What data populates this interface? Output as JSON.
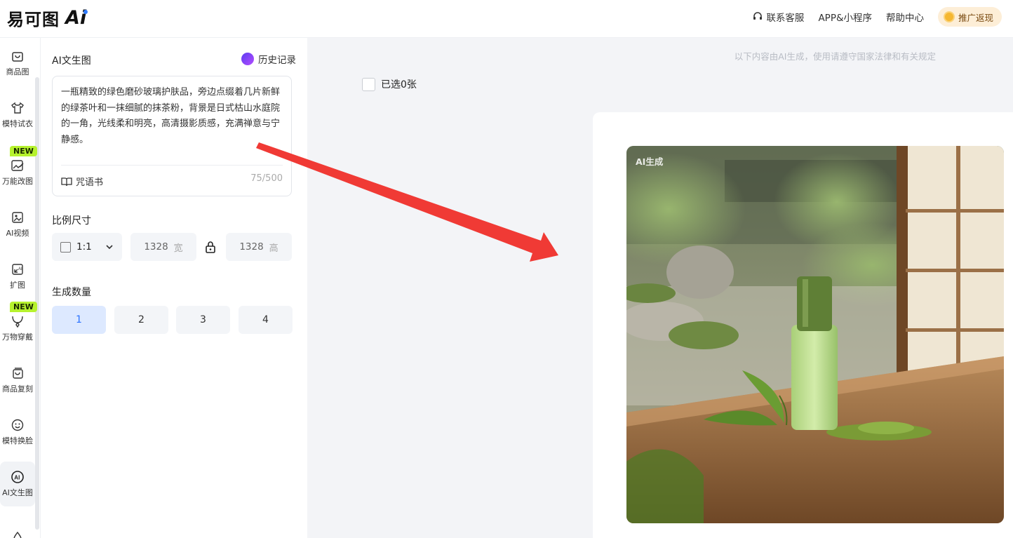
{
  "header": {
    "logo_text": "易可图",
    "logo_ai": "Ai",
    "nav": {
      "support": "联系客服",
      "app": "APP&小程序",
      "help": "帮助中心",
      "promo": "推广返现"
    }
  },
  "sidebar": {
    "items": [
      {
        "label": "商品图",
        "icon": "bag-icon"
      },
      {
        "label": "模特试衣",
        "icon": "shirt-icon"
      },
      {
        "label": "万能改图",
        "icon": "edit-image-icon",
        "badge": "NEW"
      },
      {
        "label": "AI视频",
        "icon": "video-icon"
      },
      {
        "label": "扩图",
        "icon": "expand-icon"
      },
      {
        "label": "万物穿戴",
        "icon": "necklace-icon",
        "badge": "NEW"
      },
      {
        "label": "商品复刻",
        "icon": "copy-bag-icon"
      },
      {
        "label": "模特换脸",
        "icon": "face-icon"
      },
      {
        "label": "AI文生图",
        "icon": "ai-text-image-icon",
        "active": true
      }
    ]
  },
  "panel": {
    "title": "AI文生图",
    "history": "历史记录",
    "prompt": "一瓶精致的绿色磨砂玻璃护肤品，旁边点缀着几片新鲜的绿茶叶和一抹细腻的抹茶粉，背景是日式枯山水庭院的一角，光线柔和明亮，高清摄影质感，充满禅意与宁静感。",
    "spellbook": "咒语书",
    "counter": "75/500",
    "ratio_label": "比例尺寸",
    "ratio_value": "1:1",
    "width_value": "1328",
    "width_unit": "宽",
    "height_value": "1328",
    "height_unit": "高",
    "count_label": "生成数量",
    "counts": [
      "1",
      "2",
      "3",
      "4"
    ],
    "selected_count": "1"
  },
  "main": {
    "notice": "以下内容由AI生成，使用请遵守国家法律和有关规定",
    "selected_text": "已选0张",
    "photo_tag": "AI生成"
  },
  "colors": {
    "accent": "#2a72ff",
    "new_badge": "#b6f22e",
    "arrow": "#f03a35"
  }
}
